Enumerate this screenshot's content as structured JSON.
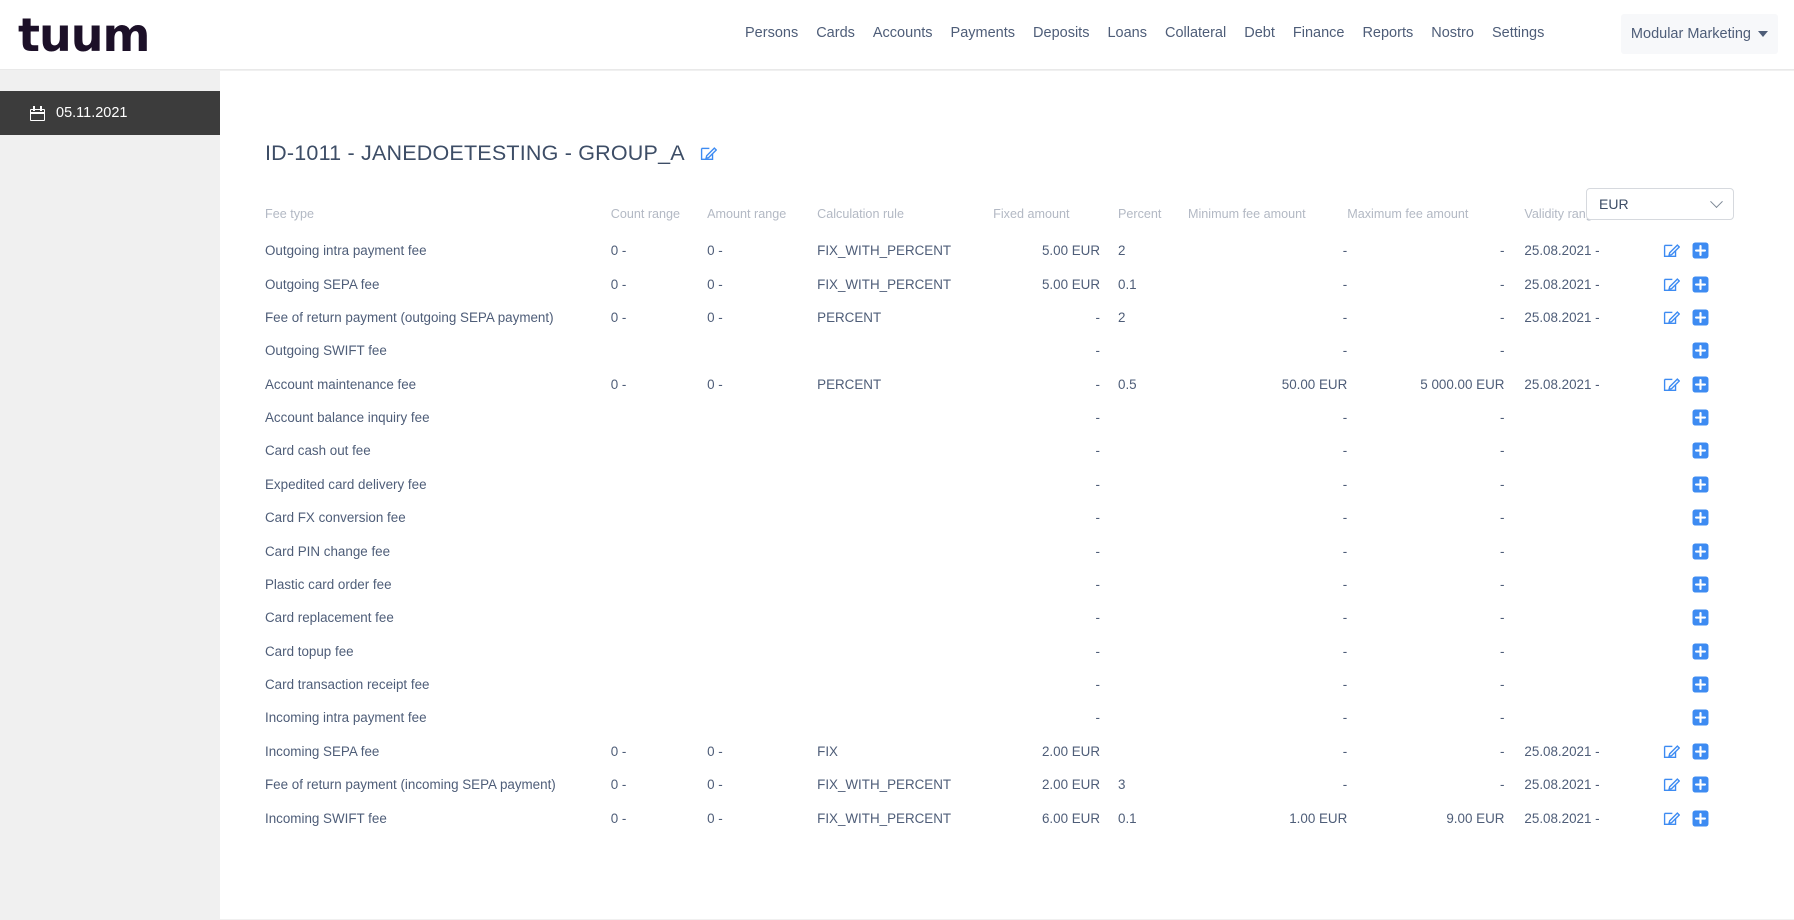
{
  "brand": {
    "logo_text": "tuum"
  },
  "nav": {
    "items": [
      {
        "label": "Persons"
      },
      {
        "label": "Cards"
      },
      {
        "label": "Accounts"
      },
      {
        "label": "Payments"
      },
      {
        "label": "Deposits"
      },
      {
        "label": "Loans"
      },
      {
        "label": "Collateral"
      },
      {
        "label": "Debt"
      },
      {
        "label": "Finance"
      },
      {
        "label": "Reports"
      },
      {
        "label": "Nostro"
      },
      {
        "label": "Settings"
      }
    ]
  },
  "user_menu": {
    "label": "Modular Marketing",
    "icon": "caret-down-icon"
  },
  "sidebar": {
    "date_item": {
      "label": "05.11.2021",
      "icon": "calendar-icon"
    }
  },
  "page": {
    "title": "ID-1011 - JANEDOETESTING - GROUP_A",
    "edit_icon": "edit-pencil-square-icon",
    "currency": {
      "value": "EUR",
      "icon": "chevron-down-icon"
    }
  },
  "table": {
    "headers": {
      "fee_type": "Fee type",
      "count_range": "Count range",
      "amount_range": "Amount range",
      "calculation_rule": "Calculation rule",
      "fixed_amount": "Fixed amount",
      "percent": "Percent",
      "minimum_fee_amount": "Minimum fee amount",
      "maximum_fee_amount": "Maximum fee amount",
      "validity_range": "Validity range"
    },
    "row_icons": {
      "edit": "edit-pencil-square-icon",
      "add": "plus-square-icon"
    },
    "rows": [
      {
        "fee_type": "Outgoing intra payment fee",
        "count_range": "0 -",
        "amount_range": "0 -",
        "calculation_rule": "FIX_WITH_PERCENT",
        "fixed_amount": "5.00 EUR",
        "percent": "2",
        "minimum_fee_amount": "-",
        "maximum_fee_amount": "-",
        "validity_range": "25.08.2021 -",
        "has_edit": true
      },
      {
        "fee_type": "Outgoing SEPA fee",
        "count_range": "0 -",
        "amount_range": "0 -",
        "calculation_rule": "FIX_WITH_PERCENT",
        "fixed_amount": "5.00 EUR",
        "percent": "0.1",
        "minimum_fee_amount": "-",
        "maximum_fee_amount": "-",
        "validity_range": "25.08.2021 -",
        "has_edit": true
      },
      {
        "fee_type": "Fee of return payment (outgoing SEPA payment)",
        "count_range": "0 -",
        "amount_range": "0 -",
        "calculation_rule": "PERCENT",
        "fixed_amount": "-",
        "percent": "2",
        "minimum_fee_amount": "-",
        "maximum_fee_amount": "-",
        "validity_range": "25.08.2021 -",
        "has_edit": true
      },
      {
        "fee_type": "Outgoing SWIFT fee",
        "count_range": "",
        "amount_range": "",
        "calculation_rule": "",
        "fixed_amount": "-",
        "percent": "",
        "minimum_fee_amount": "-",
        "maximum_fee_amount": "-",
        "validity_range": "",
        "has_edit": false
      },
      {
        "fee_type": "Account maintenance fee",
        "count_range": "0 -",
        "amount_range": "0 -",
        "calculation_rule": "PERCENT",
        "fixed_amount": "-",
        "percent": "0.5",
        "minimum_fee_amount": "50.00 EUR",
        "maximum_fee_amount": "5 000.00 EUR",
        "validity_range": "25.08.2021 -",
        "has_edit": true
      },
      {
        "fee_type": "Account balance inquiry fee",
        "count_range": "",
        "amount_range": "",
        "calculation_rule": "",
        "fixed_amount": "-",
        "percent": "",
        "minimum_fee_amount": "-",
        "maximum_fee_amount": "-",
        "validity_range": "",
        "has_edit": false
      },
      {
        "fee_type": "Card cash out fee",
        "count_range": "",
        "amount_range": "",
        "calculation_rule": "",
        "fixed_amount": "-",
        "percent": "",
        "minimum_fee_amount": "-",
        "maximum_fee_amount": "-",
        "validity_range": "",
        "has_edit": false
      },
      {
        "fee_type": "Expedited card delivery fee",
        "count_range": "",
        "amount_range": "",
        "calculation_rule": "",
        "fixed_amount": "-",
        "percent": "",
        "minimum_fee_amount": "-",
        "maximum_fee_amount": "-",
        "validity_range": "",
        "has_edit": false
      },
      {
        "fee_type": "Card FX conversion fee",
        "count_range": "",
        "amount_range": "",
        "calculation_rule": "",
        "fixed_amount": "-",
        "percent": "",
        "minimum_fee_amount": "-",
        "maximum_fee_amount": "-",
        "validity_range": "",
        "has_edit": false
      },
      {
        "fee_type": "Card PIN change fee",
        "count_range": "",
        "amount_range": "",
        "calculation_rule": "",
        "fixed_amount": "-",
        "percent": "",
        "minimum_fee_amount": "-",
        "maximum_fee_amount": "-",
        "validity_range": "",
        "has_edit": false
      },
      {
        "fee_type": "Plastic card order fee",
        "count_range": "",
        "amount_range": "",
        "calculation_rule": "",
        "fixed_amount": "-",
        "percent": "",
        "minimum_fee_amount": "-",
        "maximum_fee_amount": "-",
        "validity_range": "",
        "has_edit": false
      },
      {
        "fee_type": "Card replacement fee",
        "count_range": "",
        "amount_range": "",
        "calculation_rule": "",
        "fixed_amount": "-",
        "percent": "",
        "minimum_fee_amount": "-",
        "maximum_fee_amount": "-",
        "validity_range": "",
        "has_edit": false
      },
      {
        "fee_type": "Card topup fee",
        "count_range": "",
        "amount_range": "",
        "calculation_rule": "",
        "fixed_amount": "-",
        "percent": "",
        "minimum_fee_amount": "-",
        "maximum_fee_amount": "-",
        "validity_range": "",
        "has_edit": false
      },
      {
        "fee_type": "Card transaction receipt fee",
        "count_range": "",
        "amount_range": "",
        "calculation_rule": "",
        "fixed_amount": "-",
        "percent": "",
        "minimum_fee_amount": "-",
        "maximum_fee_amount": "-",
        "validity_range": "",
        "has_edit": false
      },
      {
        "fee_type": "Incoming intra payment fee",
        "count_range": "",
        "amount_range": "",
        "calculation_rule": "",
        "fixed_amount": "-",
        "percent": "",
        "minimum_fee_amount": "-",
        "maximum_fee_amount": "-",
        "validity_range": "",
        "has_edit": false
      },
      {
        "fee_type": "Incoming SEPA fee",
        "count_range": "0 -",
        "amount_range": "0 -",
        "calculation_rule": "FIX",
        "fixed_amount": "2.00 EUR",
        "percent": "",
        "minimum_fee_amount": "-",
        "maximum_fee_amount": "-",
        "validity_range": "25.08.2021 -",
        "has_edit": true
      },
      {
        "fee_type": "Fee of return payment (incoming SEPA payment)",
        "count_range": "0 -",
        "amount_range": "0 -",
        "calculation_rule": "FIX_WITH_PERCENT",
        "fixed_amount": "2.00 EUR",
        "percent": "3",
        "minimum_fee_amount": "-",
        "maximum_fee_amount": "-",
        "validity_range": "25.08.2021 -",
        "has_edit": true
      },
      {
        "fee_type": "Incoming SWIFT fee",
        "count_range": "0 -",
        "amount_range": "0 -",
        "calculation_rule": "FIX_WITH_PERCENT",
        "fixed_amount": "6.00 EUR",
        "percent": "0.1",
        "minimum_fee_amount": "1.00 EUR",
        "maximum_fee_amount": "9.00 EUR",
        "validity_range": "25.08.2021 -",
        "has_edit": true
      }
    ]
  },
  "colors": {
    "brand_dark": "#1c1028",
    "text_primary": "#4e5d78",
    "header_muted": "#b3b9c4",
    "accent_blue": "#3d8bf2",
    "sidebar_active": "#3c3c3c",
    "sidebar_bg": "#f0f0f0"
  }
}
